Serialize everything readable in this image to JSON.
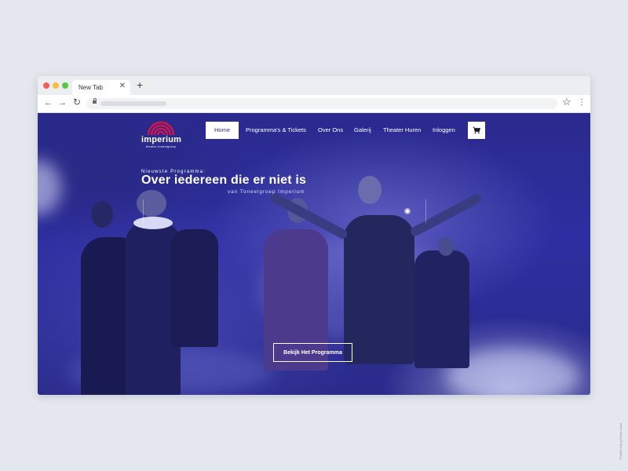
{
  "browser": {
    "tab_title": "New Tab",
    "tab_close": "✕",
    "new_tab": "+",
    "back": "←",
    "forward": "→",
    "reload": "↻",
    "bookmark": "☆",
    "menu": "⋮"
  },
  "site": {
    "logo_name": "imperium",
    "logo_tagline": "theater-toneelgroep",
    "nav": [
      {
        "label": "Home",
        "active": true
      },
      {
        "label": "Programma's & Tickets"
      },
      {
        "label": "Over Ons"
      },
      {
        "label": "Galerij"
      },
      {
        "label": "Theater Huren"
      },
      {
        "label": "Inloggen"
      }
    ],
    "cart_icon": "cart-icon"
  },
  "hero": {
    "kicker": "Nieuwste Programma:",
    "title": "Over iedereen die er niet is",
    "byline": "van Toneelgroep Imperium",
    "cta": "Bekijk Het Programma"
  },
  "credit": "Posted Using Clean mock",
  "colors": {
    "brand_red": "#d6144b",
    "hero_blue": "#2e2ea2",
    "active_text": "#2e2f8f"
  }
}
